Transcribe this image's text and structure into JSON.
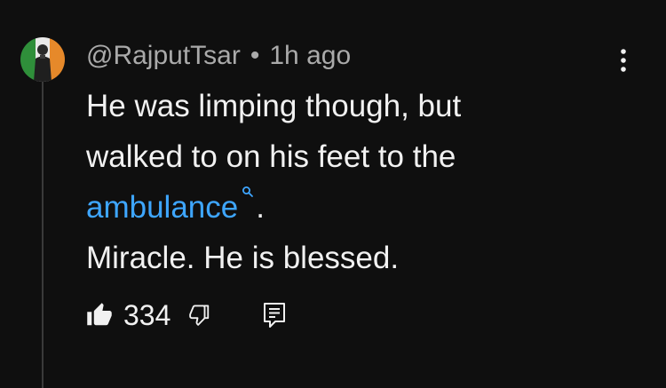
{
  "comment": {
    "author": "@RajputTsar",
    "separator": "•",
    "time": "1h ago",
    "text_line1": "He was limping though, but",
    "text_line2": "walked to on his feet to the",
    "link_text": "ambulance",
    "after_link": ".",
    "text_line4": "Miracle. He is blessed.",
    "like_count": "334"
  },
  "colors": {
    "background": "#0f0f0f",
    "text": "#f1f1f1",
    "secondary_text": "#aaaaaa",
    "link": "#3ea6ff"
  },
  "icons": {
    "avatar": "avatar-tricolor-icon",
    "more": "more-vertical-icon",
    "like": "thumbs-up-filled-icon",
    "dislike": "thumbs-down-outline-icon",
    "reply": "reply-comment-icon",
    "search": "search-icon"
  }
}
